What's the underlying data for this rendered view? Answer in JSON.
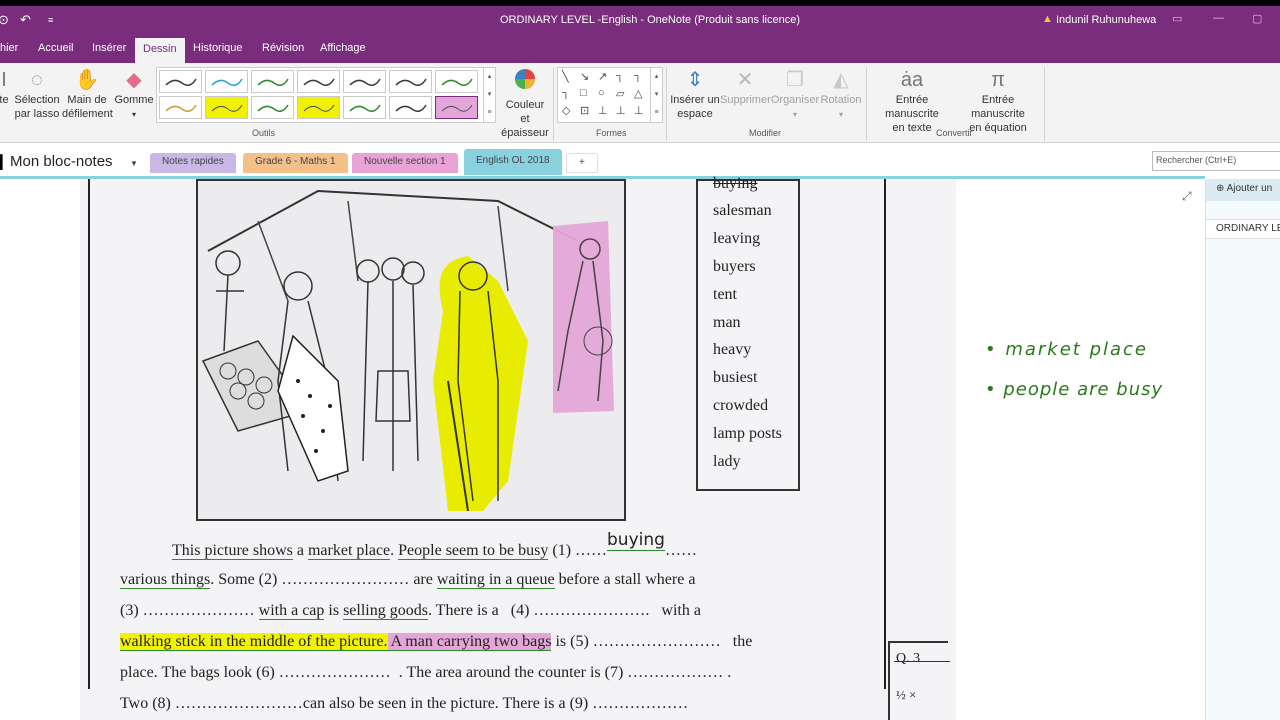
{
  "window": {
    "title": "ORDINARY LEVEL -English  -  OneNote (Produit sans licence)",
    "user": "Indunil Ruhunuhewa"
  },
  "menu": {
    "items": [
      "hier",
      "Accueil",
      "Insérer",
      "Dessin",
      "Historique",
      "Révision",
      "Affichage"
    ],
    "active": "Dessin"
  },
  "ribbon": {
    "select_lasso_line1": "Sélection",
    "select_lasso_line2": "par lasso",
    "hand_line1": "Main de",
    "hand_line2": "défilement",
    "eraser": "Gomme",
    "color_thickness_line1": "Couleur et",
    "color_thickness_line2": "épaisseur",
    "insert_space_line1": "Insérer un",
    "insert_space_line2": "espace",
    "delete": "Supprimer",
    "arrange": "Organiser",
    "rotate": "Rotation",
    "ink_text_line1": "Entrée manuscrite",
    "ink_text_line2": "en texte",
    "ink_math_line1": "Entrée manuscrite",
    "ink_math_line2": "en équation",
    "group_tools": "Outils",
    "group_shapes": "Formes",
    "group_modify": "Modifier",
    "group_convert": "Convertir",
    "pen_colors": [
      "#3d3d3d",
      "#2aa1d9",
      "#2e8a2e",
      "#3d3d3d",
      "#3d3d3d",
      "#3d3d3d",
      "#2e8a2e",
      "#c79a3a",
      "#f0f200",
      "#2e8a2e",
      "#f0f200",
      "#2e8a2e",
      "#3d3d3d",
      "#e4a6d8"
    ]
  },
  "notebook": {
    "name": "Mon bloc-notes",
    "sections": [
      {
        "label": "Notes rapides",
        "color": "#c9b7e6"
      },
      {
        "label": "Grade 6 - Maths 1",
        "color": "#f3c089"
      },
      {
        "label": "Nouvelle section 1",
        "color": "#eaa3d6"
      },
      {
        "label": "English OL 2018",
        "color": "#8ad1df"
      }
    ],
    "add_section": "+",
    "search_placeholder": "Rechercher (Ctrl+E)"
  },
  "pages_pane": {
    "add_page": "Ajouter un",
    "page_item": "ORDINARY LE"
  },
  "worksheet": {
    "words": [
      "buying",
      "salesman",
      "leaving",
      "buyers",
      "tent",
      "man",
      "heavy",
      "busiest",
      "crowded",
      "lamp posts",
      "lady"
    ],
    "line1": {
      "a": "This picture shows",
      "b": " a ",
      "c": "market place",
      "d": ". ",
      "e": "People seem to be busy",
      "f": " (1) ……",
      "g": "buying",
      "h": "……"
    },
    "line2": {
      "a": "various things",
      "b": ". Some (2) …………………… are ",
      "c": "waiting in a queue",
      "d": " before a stall where a"
    },
    "line3": {
      "a": "(3) ………………… ",
      "b": "with a cap",
      "c": " is ",
      "d": "selling goods",
      "e": ". There is a   (4) ………………….   with a"
    },
    "line4": {
      "a": "walking stick in the middle of the picture.",
      "b": " A man carrying two bags",
      "c": " is (5) ……………………   the"
    },
    "line5": "place. The bags look (6) …………………  . The area around the counter is (7) ……………… .",
    "line6": "Two (8) ……………………can also be seen in the picture. There is a (9) ………………",
    "q3_label": "Q. 3",
    "q3_mark": "½ ×"
  },
  "handwritten_notes": [
    "• market place",
    "• people are busy"
  ]
}
